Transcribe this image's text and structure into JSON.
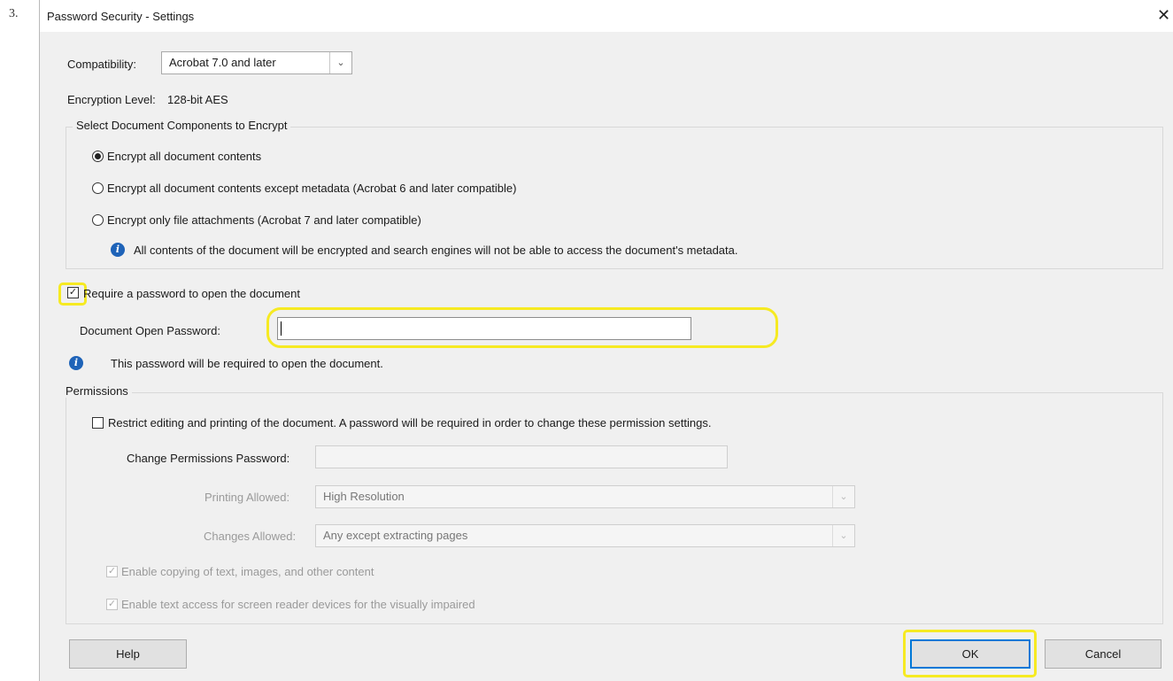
{
  "step_marker": "3.",
  "dialog": {
    "title": "Password Security - Settings",
    "close_glyph": "✕"
  },
  "compatibility": {
    "label": "Compatibility:",
    "value": "Acrobat 7.0 and later"
  },
  "encryption": {
    "label": "Encryption Level:",
    "value": "128-bit AES"
  },
  "components": {
    "legend": "Select Document Components to Encrypt",
    "options": [
      {
        "label": "Encrypt all document contents",
        "selected": true
      },
      {
        "label": "Encrypt all document contents except metadata (Acrobat 6 and later compatible)",
        "selected": false
      },
      {
        "label": "Encrypt only file attachments (Acrobat 7 and later compatible)",
        "selected": false
      }
    ],
    "info_text": "All contents of the document will be encrypted and search engines will not be able to access the document's metadata."
  },
  "open_password": {
    "require_label": "Require a password to open the document",
    "require_checked": true,
    "field_label": "Document Open Password:",
    "field_value": "",
    "info_text": "This password will be required to open the document."
  },
  "permissions": {
    "legend": "Permissions",
    "restrict_label": "Restrict editing and printing of the document. A password will be required in order to change these permission settings.",
    "restrict_checked": false,
    "change_password_label": "Change Permissions Password:",
    "change_password_value": "",
    "printing_label": "Printing Allowed:",
    "printing_value": "High Resolution",
    "changes_label": "Changes Allowed:",
    "changes_value": "Any except extracting pages",
    "copy_label": "Enable copying of text, images, and other content",
    "copy_checked": true,
    "screen_reader_label": "Enable text access for screen reader devices for the visually impaired",
    "screen_reader_checked": true
  },
  "buttons": {
    "help": "Help",
    "ok": "OK",
    "cancel": "Cancel"
  },
  "icons": {
    "dropdown": "chevron-down-icon",
    "info": "info-icon",
    "close": "close-icon",
    "check": "✓"
  },
  "colors": {
    "highlight": "#f6ea22",
    "info_blue": "#1e63b8",
    "default_button_border": "#0078d7"
  }
}
